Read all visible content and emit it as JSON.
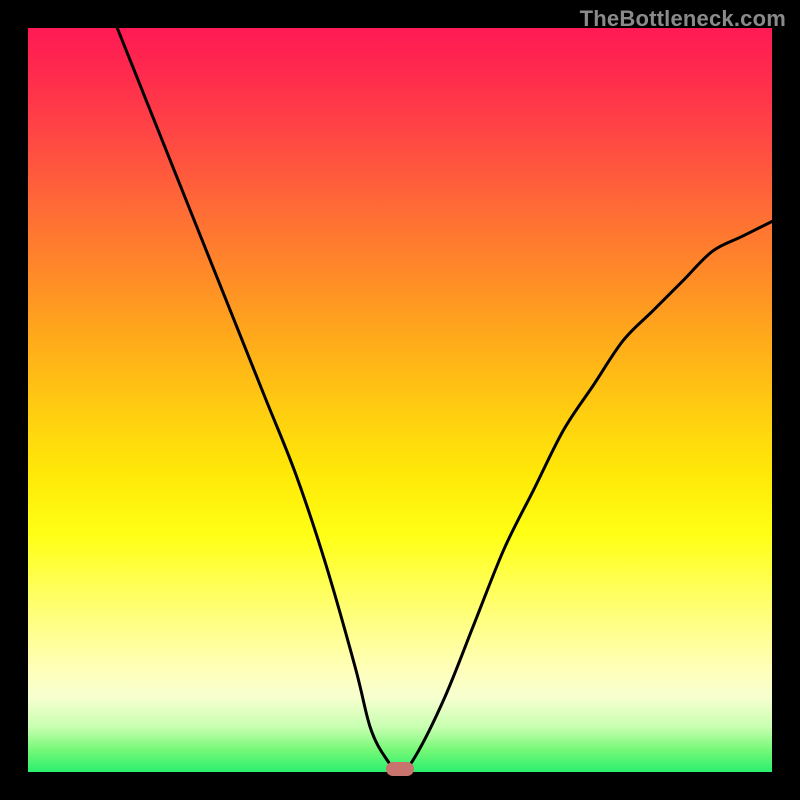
{
  "watermark": "TheBottleneck.com",
  "chart_data": {
    "type": "line",
    "title": "",
    "xlabel": "",
    "ylabel": "",
    "xlim": [
      0,
      100
    ],
    "ylim": [
      0,
      100
    ],
    "grid": false,
    "legend": false,
    "series": [
      {
        "name": "bottleneck-curve",
        "x": [
          12,
          16,
          20,
          24,
          28,
          32,
          36,
          40,
          44,
          46,
          48,
          50,
          52,
          56,
          60,
          64,
          68,
          72,
          76,
          80,
          84,
          88,
          92,
          96,
          100
        ],
        "y": [
          100,
          90,
          80,
          70,
          60,
          50,
          40,
          28,
          14,
          6,
          2,
          0,
          2,
          10,
          20,
          30,
          38,
          46,
          52,
          58,
          62,
          66,
          70,
          72,
          74
        ]
      }
    ],
    "marker": {
      "x": 50,
      "y": 0
    },
    "background_gradient": {
      "top": "#ff1a55",
      "mid": "#ffff14",
      "bottom": "#2aef6f"
    },
    "curve_color": "#000000",
    "marker_color": "#c9736e"
  }
}
